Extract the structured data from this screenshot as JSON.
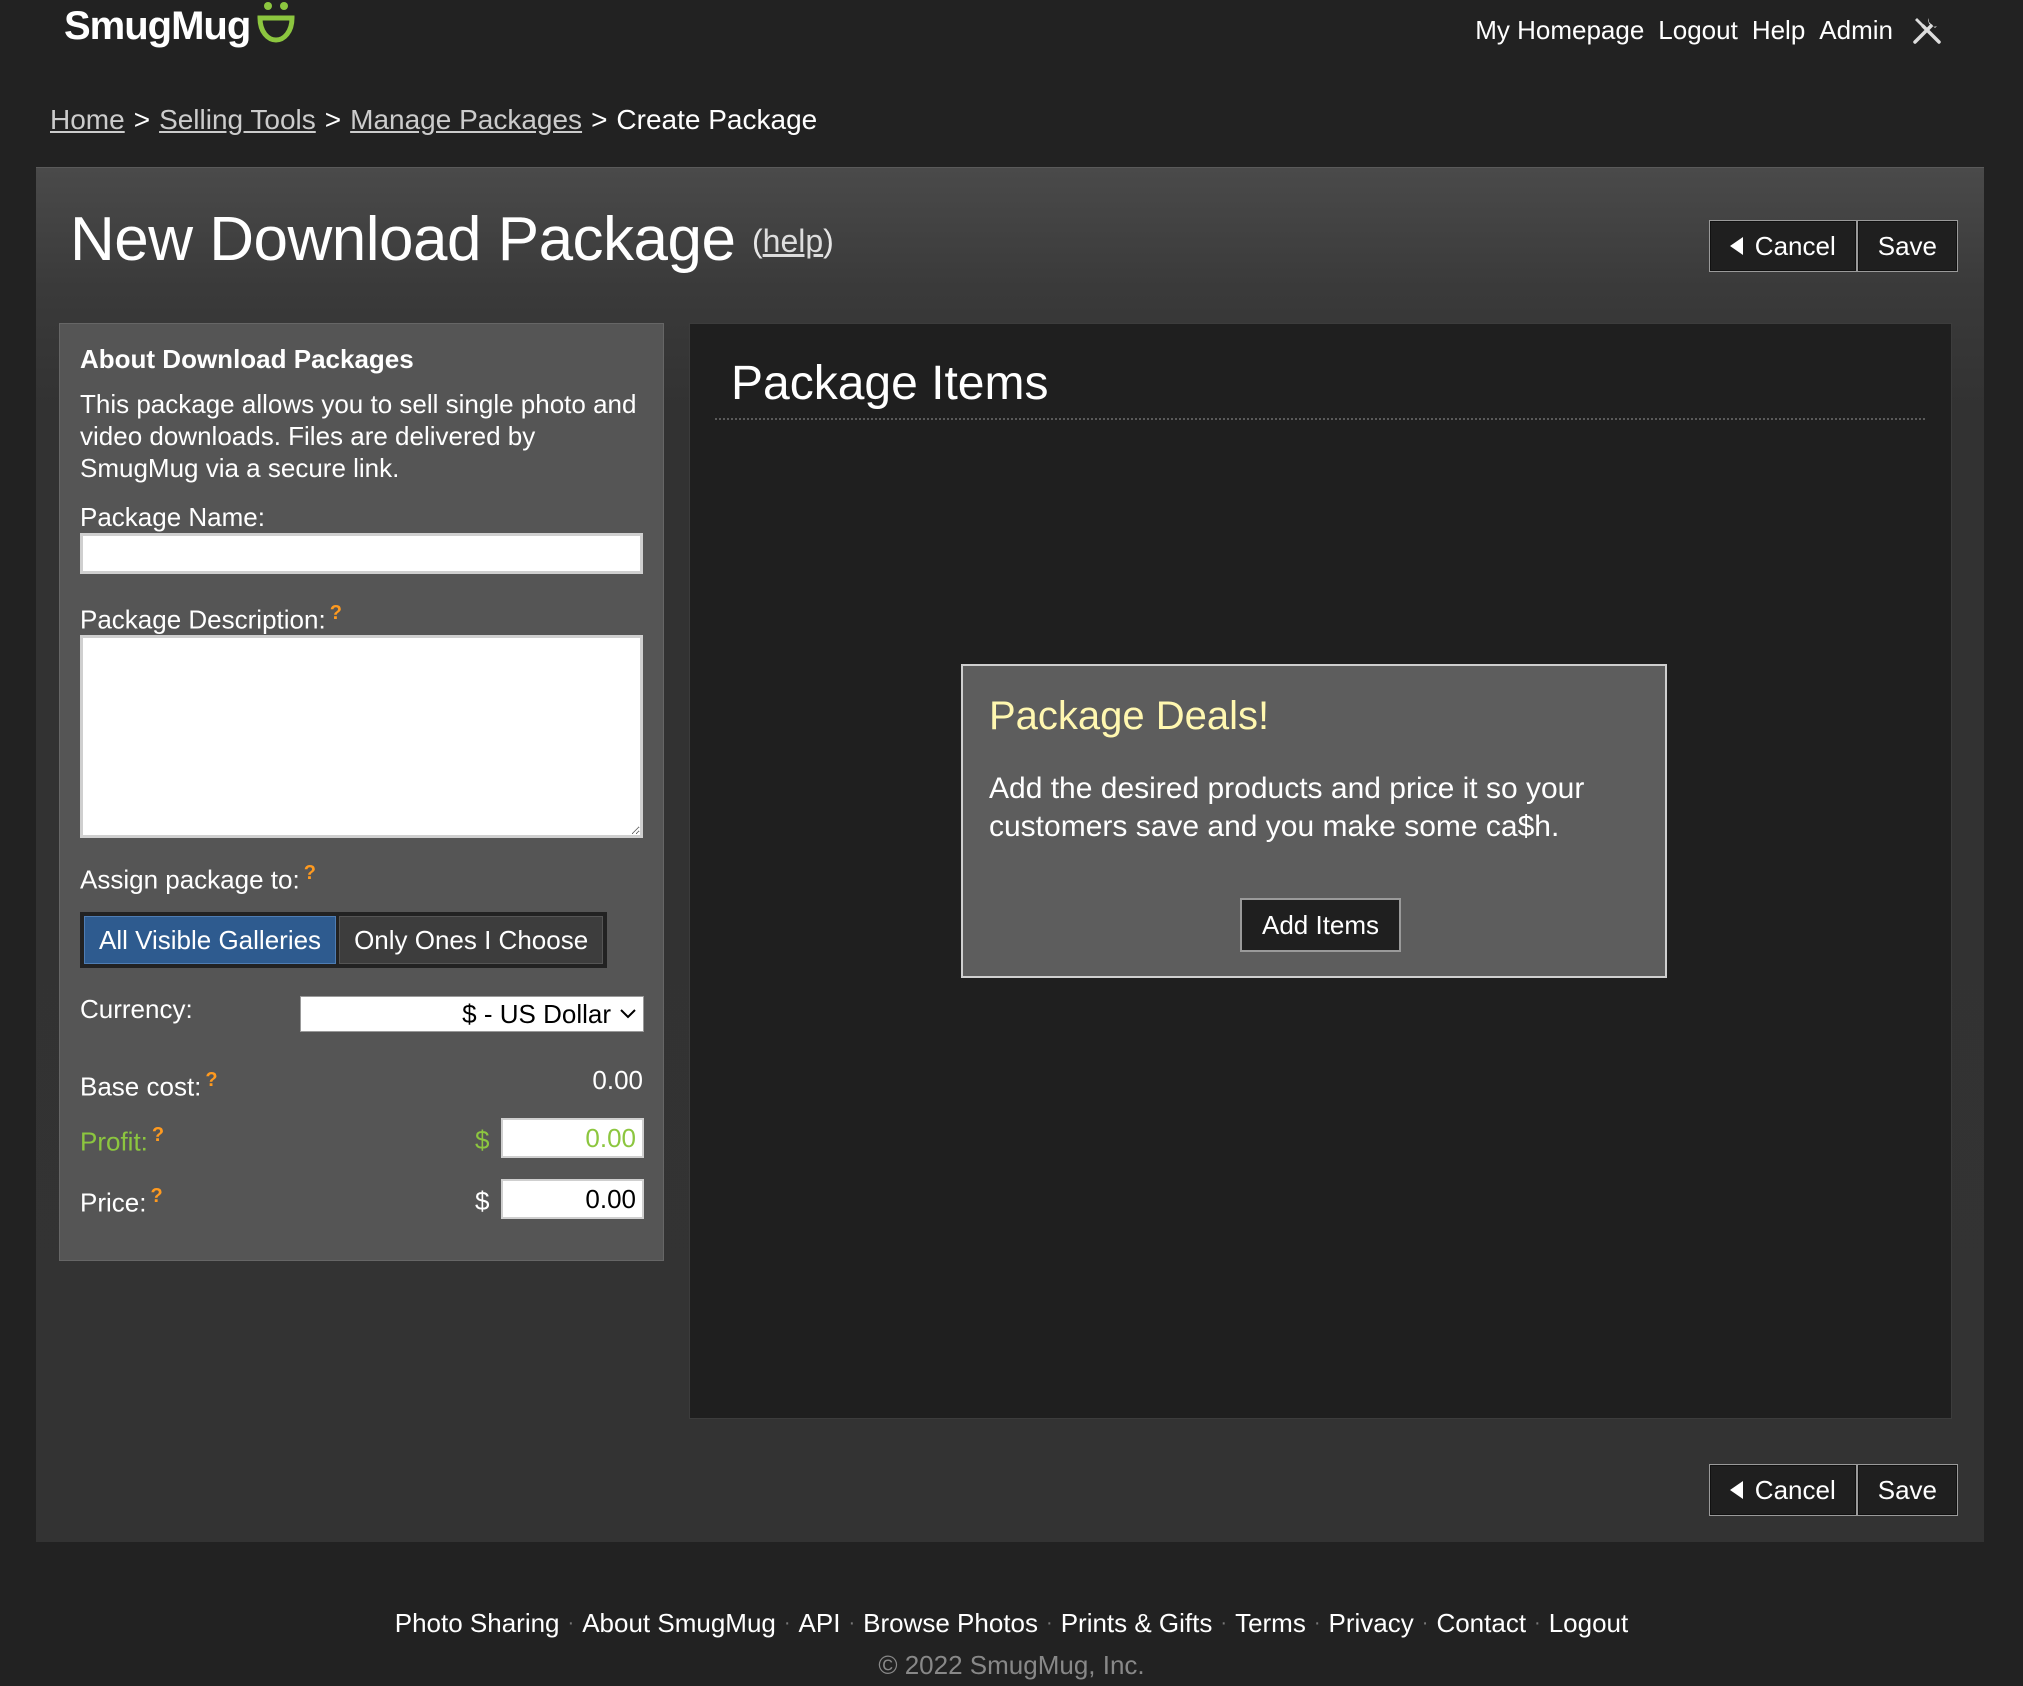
{
  "brand": {
    "name": "SmugMug",
    "accent_color": "#8cc63f"
  },
  "topnav": {
    "items": [
      "My Homepage",
      "Logout",
      "Help",
      "Admin"
    ],
    "admin_icon": "tools-icon"
  },
  "breadcrumb": {
    "home": "Home",
    "selling_tools": "Selling Tools",
    "manage_packages": "Manage Packages",
    "current": "Create Package",
    "separator": ">"
  },
  "page": {
    "title": "New Download Package",
    "help_open": "(",
    "help_label": "help",
    "help_close": ")"
  },
  "actions": {
    "cancel_label": "Cancel",
    "save_label": "Save"
  },
  "sidebar": {
    "heading": "About Download Packages",
    "description": "This package allows you to sell single photo and video downloads. Files are delivered by SmugMug via a secure link.",
    "package_name_label": "Package Name:",
    "package_name_value": "",
    "package_description_label": "Package Description:",
    "package_description_value": "",
    "assign_label": "Assign package to:",
    "assign_options": [
      "All Visible Galleries",
      "Only Ones I Choose"
    ],
    "assign_selected": "All Visible Galleries",
    "currency_label": "Currency:",
    "currency_value": "$ - US Dollar",
    "base_cost_label": "Base cost:",
    "base_cost_value": "0.00",
    "profit_label": "Profit:",
    "profit_currency": "$",
    "profit_value": "0.00",
    "price_label": "Price:",
    "price_currency": "$",
    "price_value": "0.00",
    "help_mark": "?"
  },
  "content": {
    "title": "Package Items",
    "deal_title": "Package Deals!",
    "deal_text": "Add the desired products and price it so your customers save and you make some ca$h.",
    "add_items_label": "Add Items"
  },
  "footer": {
    "links": [
      "Photo Sharing",
      "About SmugMug",
      "API",
      "Browse Photos",
      "Prints & Gifts",
      "Terms",
      "Privacy",
      "Contact",
      "Logout"
    ],
    "copyright": "© 2022 SmugMug, Inc."
  }
}
